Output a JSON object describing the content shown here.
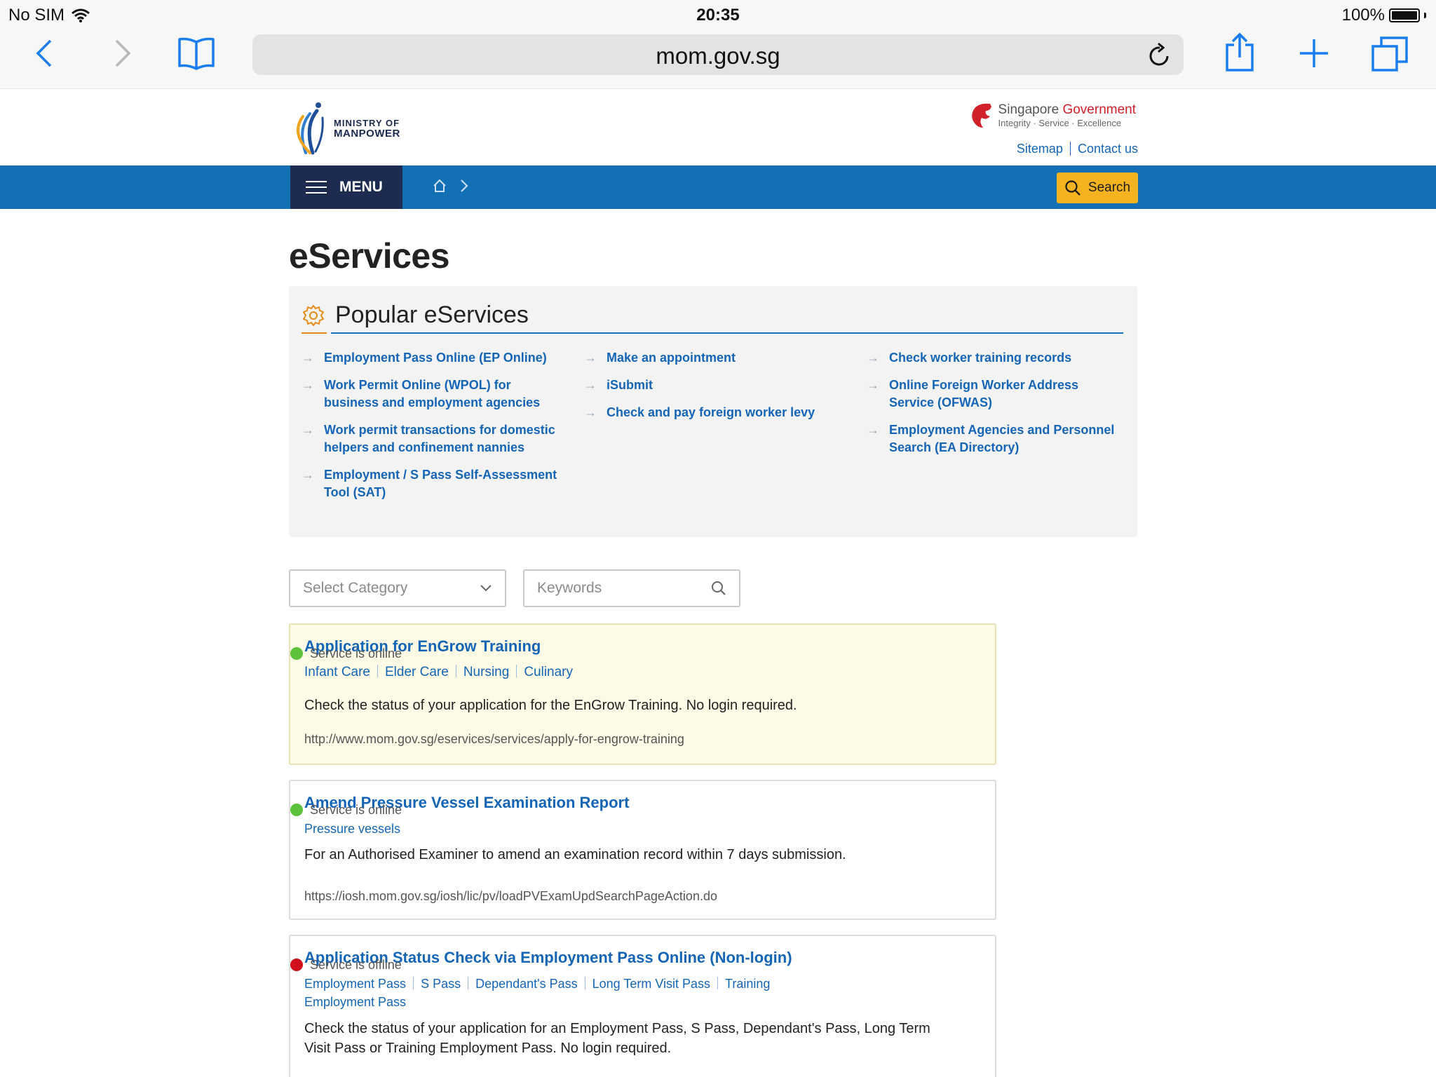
{
  "status_bar": {
    "carrier": "No SIM",
    "time": "20:35",
    "battery": "100%"
  },
  "browser": {
    "url": "mom.gov.sg"
  },
  "site": {
    "logo_line1": "MINISTRY OF",
    "logo_line2": "MANPOWER",
    "gov_title_a": "Singapore",
    "gov_title_b": "Government",
    "gov_tagline": "Integrity · Service · Excellence",
    "link_sitemap": "Sitemap",
    "link_contact": "Contact us"
  },
  "nav": {
    "menu_label": "MENU",
    "search_label": "Search"
  },
  "page": {
    "title": "eServices"
  },
  "popular": {
    "heading": "Popular eServices",
    "col1": [
      "Employment Pass Online (EP Online)",
      "Work Permit Online (WPOL) for business and employment agencies",
      "Work permit transactions for domestic helpers and confinement nannies",
      "Employment / S Pass Self-Assessment Tool (SAT)"
    ],
    "col2": [
      "Make an appointment",
      "iSubmit",
      "Check and pay foreign worker levy"
    ],
    "col3": [
      "Check worker training records",
      "Online Foreign Worker Address Service (OFWAS)",
      "Employment Agencies and Personnel Search (EA Directory)"
    ]
  },
  "filters": {
    "category_placeholder": "Select Category",
    "keywords_placeholder": "Keywords"
  },
  "results": [
    {
      "title": "Application for EnGrow Training",
      "status": "Service is online",
      "status_color": "#5cc13b",
      "tags": [
        "Infant Care",
        "Elder Care",
        "Nursing",
        "Culinary"
      ],
      "description": "Check the status of your application for the EnGrow Training. No login required.",
      "url": "http://www.mom.gov.sg/eservices/services/apply-for-engrow-training"
    },
    {
      "title": "Amend Pressure Vessel Examination Report",
      "status": "Service is online",
      "status_color": "#5cc13b",
      "tags": [
        "Pressure vessels"
      ],
      "description": "For an Authorised Examiner to amend an examination record within 7 days submission.",
      "url": "https://iosh.mom.gov.sg/iosh/lic/pv/loadPVExamUpdSearchPageAction.do"
    },
    {
      "title": "Application Status Check via Employment Pass Online (Non-login)",
      "status": "Service is offline",
      "status_color": "#d0101b",
      "tags": [
        "Employment Pass",
        "S Pass",
        "Dependant's Pass",
        "Long Term Visit Pass",
        "Training Employment Pass"
      ],
      "description": "Check the status of your application for an Employment Pass, S Pass, Dependant's Pass, Long Term Visit Pass or Training Employment Pass. No login required."
    }
  ],
  "colors": {
    "nav_blue": "#1470b5",
    "menu_navy": "#1c2b4f",
    "search_yellow": "#f6b320",
    "link_blue": "#1565b6"
  }
}
